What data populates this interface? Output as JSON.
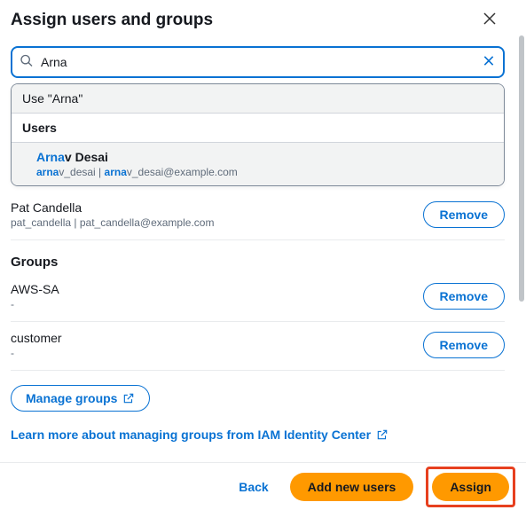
{
  "dialog": {
    "title": "Assign users and groups"
  },
  "search": {
    "value": "Arna"
  },
  "dropdown": {
    "useQuoted": "Use \"Arna\"",
    "sectionLabel": "Users",
    "match": {
      "hl": "Arna",
      "rest": "v Desai",
      "sub_hl1": "arna",
      "sub_r1": "v_desai | ",
      "sub_hl2": "arna",
      "sub_r2": "v_desai@example.com"
    }
  },
  "existingUser": {
    "name": "Pat Candella",
    "sub": "pat_candella | pat_candella@example.com",
    "removeLabel": "Remove"
  },
  "groupsHeader": "Groups",
  "groups": [
    {
      "name": "AWS-SA",
      "sub": "-",
      "removeLabel": "Remove"
    },
    {
      "name": "customer",
      "sub": "-",
      "removeLabel": "Remove"
    }
  ],
  "manageGroupsLabel": "Manage groups",
  "learnLink": "Learn more about managing groups from IAM Identity Center",
  "footer": {
    "back": "Back",
    "addNew": "Add new users",
    "assign": "Assign"
  }
}
